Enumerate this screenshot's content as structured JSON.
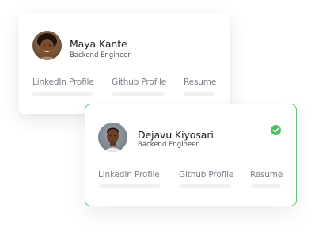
{
  "cards": [
    {
      "name": "Maya Kante",
      "role": "Backend Engineer",
      "links": [
        "LinkedIn Profile",
        "Github Profile",
        "Resume"
      ],
      "selected": false
    },
    {
      "name": "Dejavu Kiyosari",
      "role": "Backend Engineer",
      "links": [
        "LinkedIn Profile",
        "Github Profile",
        "Resume"
      ],
      "selected": true
    }
  ],
  "icons": {
    "selected_indicator": "check-circle-icon"
  },
  "colors": {
    "accent_green": "#4fc162",
    "selected_border": "#61c46f",
    "name_text": "#1b1d22",
    "muted_text": "#7d818a",
    "placeholder": "#f0f1f3"
  }
}
